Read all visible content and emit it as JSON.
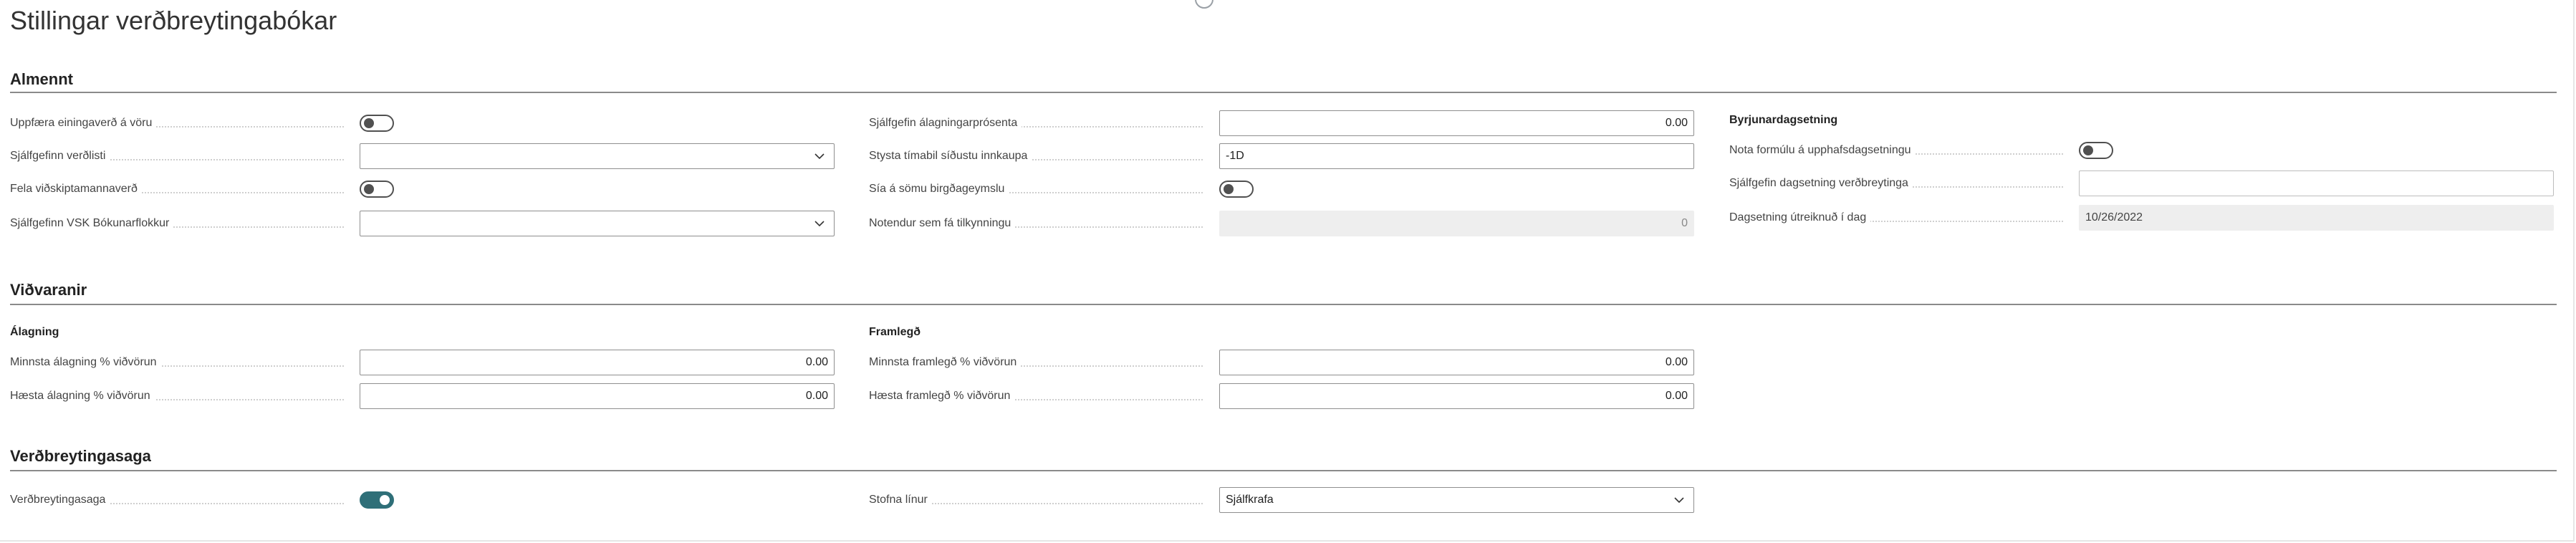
{
  "page": {
    "title": "Stillingar verðbreytingabókar"
  },
  "sections": {
    "almennt": {
      "title": "Almennt",
      "fields": {
        "uppfaera_einingaverd": {
          "label": "Uppfæra einingaverð á vöru",
          "value": false
        },
        "sjalfgefinn_verdlisti": {
          "label": "Sjálfgefinn verðlisti",
          "value": ""
        },
        "fela_vidskiptamannaverd": {
          "label": "Fela viðskiptamannaverð",
          "value": false
        },
        "sjalfgefinn_vsk": {
          "label": "Sjálfgefinn VSK Bókunarflokkur",
          "value": ""
        },
        "sjalfgefin_alagningarprosenta": {
          "label": "Sjálfgefin álagningarprósenta",
          "value": "0.00"
        },
        "stysta_timabil": {
          "label": "Stysta tímabil síðustu innkaupa",
          "value": "-1D"
        },
        "sia_somu_birgdageymslu": {
          "label": "Sía á sömu birgðageymslu",
          "value": false
        },
        "notendur_tilkynningu": {
          "label": "Notendur sem fá tilkynningu",
          "value": "0"
        }
      },
      "byrjunar": {
        "title": "Byrjunardagsetning",
        "fields": {
          "nota_formulu": {
            "label": "Nota formúlu á upphafsdagsetningu",
            "value": false
          },
          "sjalfgefin_dagsetning": {
            "label": "Sjálfgefin dagsetning verðbreytinga",
            "value": ""
          },
          "dagsetning_utreiknud": {
            "label": "Dagsetning útreiknuð í dag",
            "value": "10/26/2022"
          }
        }
      }
    },
    "vidvaranir": {
      "title": "Viðvaranir",
      "alagning": {
        "title": "Álagning",
        "fields": {
          "minnsta_alagning": {
            "label": "Minnsta álagning % viðvörun",
            "value": "0.00"
          },
          "haesta_alagning": {
            "label": "Hæsta álagning % viðvörun",
            "value": "0.00"
          }
        }
      },
      "framlegd": {
        "title": "Framlegð",
        "fields": {
          "minnsta_framlegd": {
            "label": "Minnsta framlegð % viðvörun",
            "value": "0.00"
          },
          "haesta_framlegd": {
            "label": "Hæsta framlegð % viðvörun",
            "value": "0.00"
          }
        }
      }
    },
    "verdbreytingasaga": {
      "title": "Verðbreytingasaga",
      "fields": {
        "verdbreytingasaga": {
          "label": "Verðbreytingasaga",
          "value": true
        },
        "stofna_linur": {
          "label": "Stofna línur",
          "value": "Sjálfkrafa"
        }
      }
    }
  },
  "colors": {
    "toggle_on": "#2f6f78",
    "toggle_off": "#505050",
    "readonly_bg": "#eeeeee",
    "section_rule": "#8a8a8a"
  },
  "icons": {
    "dropdown": "chevron-down-icon",
    "toggle_knob": "toggle-knob-icon"
  }
}
